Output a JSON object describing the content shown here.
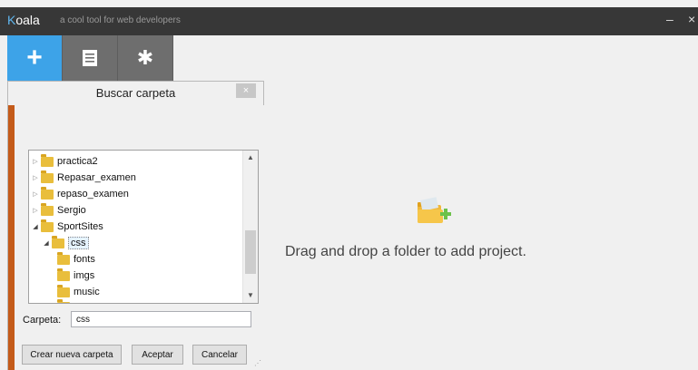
{
  "app": {
    "name_prefix": "K",
    "name_rest": "oala",
    "subtitle": "a cool tool for web developers",
    "minimize_glyph": "–",
    "close_glyph": "×"
  },
  "toolbar": {
    "buttons": [
      {
        "icon": "plus-icon",
        "glyph": "+",
        "active": true
      },
      {
        "icon": "document-icon",
        "active": false
      },
      {
        "icon": "gear-icon",
        "glyph": "✱",
        "active": false
      }
    ]
  },
  "main": {
    "empty_message": "Drag and drop a folder to add project."
  },
  "dialog": {
    "title": "Buscar carpeta",
    "close_glyph": "×",
    "tree": [
      {
        "label": "practica2",
        "expanded": false,
        "selected": false
      },
      {
        "label": "Repasar_examen",
        "expanded": false,
        "selected": false
      },
      {
        "label": "repaso_examen",
        "expanded": false,
        "selected": false
      },
      {
        "label": "Sergio",
        "expanded": false,
        "selected": false
      },
      {
        "label": "SportSites",
        "expanded": true,
        "selected": false
      },
      {
        "label": "css",
        "expanded": true,
        "selected": true
      },
      {
        "label": "fonts",
        "expanded": false,
        "selected": false
      },
      {
        "label": "imgs",
        "expanded": false,
        "selected": false
      },
      {
        "label": "music",
        "expanded": false,
        "selected": false
      }
    ],
    "folder_label": "Carpeta:",
    "folder_value": "css",
    "btn_new_folder": "Crear nueva carpeta",
    "btn_accept": "Aceptar",
    "btn_cancel": "Cancelar"
  },
  "colors": {
    "titlebar": "#373737",
    "accent": "#3da3e8",
    "toolbar_button": "#6e6e6e",
    "folder": "#e9be3c",
    "dialog_strip": "#c45b1a"
  }
}
